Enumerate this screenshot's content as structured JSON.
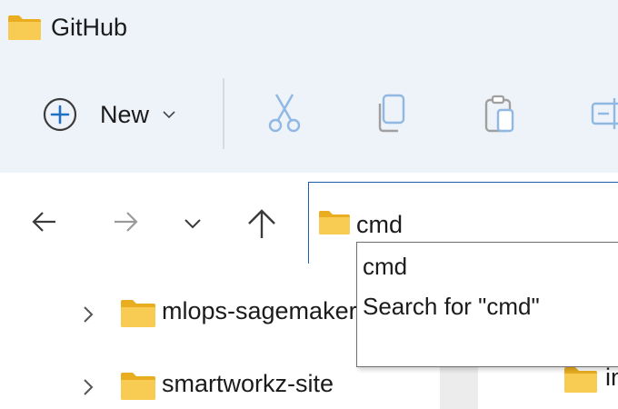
{
  "window": {
    "title": "GitHub",
    "title_icon": "folder-icon"
  },
  "command_bar": {
    "new_label": "New",
    "new_icon": "plus-circle-icon",
    "buttons": [
      {
        "name": "cut",
        "icon": "scissors-icon"
      },
      {
        "name": "copy",
        "icon": "copy-icon"
      },
      {
        "name": "paste",
        "icon": "clipboard-icon"
      },
      {
        "name": "rename",
        "icon": "rename-icon"
      }
    ]
  },
  "navigation": {
    "back_icon": "arrow-left-icon",
    "forward_icon": "arrow-right-icon",
    "recent_icon": "chevron-down-icon",
    "up_icon": "arrow-up-icon"
  },
  "address_bar": {
    "value": "cmd",
    "icon": "folder-icon"
  },
  "autocomplete": {
    "items": [
      "cmd",
      "Search for \"cmd\""
    ]
  },
  "tree": {
    "items": [
      {
        "label": "mlops-sagemaker"
      },
      {
        "label": "smartworkz-site"
      }
    ]
  },
  "content": {
    "partial_label": "in"
  },
  "colors": {
    "chrome_bg": "#eef2f9",
    "accent_blue": "#1e5ea8",
    "folder_yellow": "#f6c543",
    "icon_blue": "#8fb8e3"
  }
}
